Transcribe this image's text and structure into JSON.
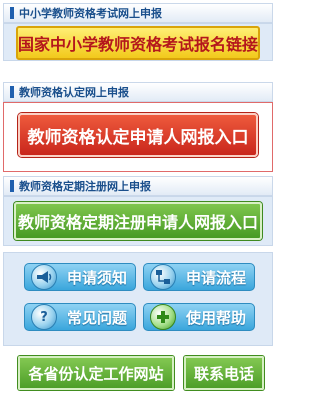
{
  "sections": {
    "primary_school": {
      "title": "中小学教师资格考试网上申报",
      "button_label": "国家中小学教师资格考试报名链接"
    },
    "certification": {
      "title": "教师资格认定网上申报",
      "button_label": "教师资格认定申请人网报入口"
    },
    "registration": {
      "title": "教师资格定期注册网上申报",
      "button_label": "教师资格定期注册申请人网报入口"
    }
  },
  "quick_links": {
    "notice": {
      "label": "申请须知",
      "icon": "megaphone-icon"
    },
    "process": {
      "label": "申请流程",
      "icon": "flowchart-icon"
    },
    "faq": {
      "label": "常见问题",
      "icon": "question-icon"
    },
    "help": {
      "label": "使用帮助",
      "icon": "plus-icon"
    }
  },
  "bottom": {
    "provinces_label": "各省份认定工作网站",
    "contact_label": "联系电话"
  },
  "colors": {
    "header_text": "#1a4f8c",
    "yellow_button": "#f2c91b",
    "red_button": "#c9261c",
    "green_button": "#479a24",
    "quick_link": "#3aa6dc",
    "highlight_border": "#e06a6a"
  }
}
